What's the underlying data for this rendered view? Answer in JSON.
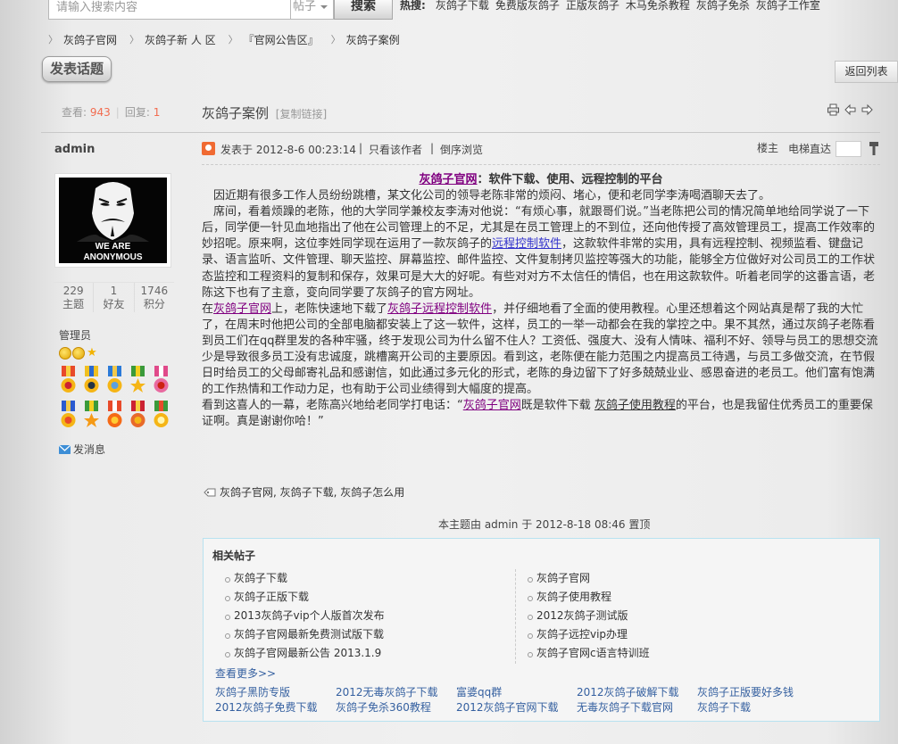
{
  "search": {
    "placeholder": "请输入搜索内容",
    "type": "帖子",
    "button": "搜索"
  },
  "hot": {
    "label": "热搜:",
    "items": [
      "灰鸽子下载",
      "免费版灰鸽子",
      "正版灰鸽子",
      "木马免杀教程",
      "灰鸽子免杀",
      "灰鸽子工作室"
    ]
  },
  "breadcrumb": [
    "灰鸽子官网",
    "灰鸽子新 人 区",
    "『官网公告区』",
    "灰鸽子案例"
  ],
  "post_button": "发表话题",
  "back_list": "返回列表",
  "thread": {
    "views_label": "查看:",
    "views": "943",
    "replies_label": "回复:",
    "replies": "1",
    "title": "灰鸽子案例",
    "copy_link": "[复制链接]"
  },
  "author": {
    "name": "admin",
    "avatar_text": [
      "WE ARE",
      "ANONYMOUS"
    ],
    "stats": [
      {
        "value": "229",
        "label": "主题"
      },
      {
        "value": "1",
        "label": "好友"
      },
      {
        "value": "1746",
        "label": "积分"
      }
    ],
    "group": "管理员",
    "message": "发消息"
  },
  "post_info": {
    "posted": "发表于  2012-8-6 00:23:14",
    "only_author": "只看该作者",
    "reverse": "倒序浏览",
    "floor_owner": "楼主",
    "jump": "电梯直达"
  },
  "post": {
    "heading_link": "灰鸽子官网",
    "heading_rest": "：软件下载、使用、远程控制的平台",
    "p1": "因近期有很多工作人员纷纷跳槽，某文化公司的领导老陈非常的烦闷、堵心，便和老同学李涛喝酒聊天去了。",
    "p2a": "席间，看着烦躁的老陈，他的大学同学兼校友李涛对他说：“有烦心事，就跟哥们说。”当老陈把公司的情况简单地给同学说了一下后，同学便一针见血地指出了他在公司管理上的不足，尤其是在员工管理上的不到位，还向他传授了高效管理员工，提高工作效率的妙招呢。原来啊，这位李姓同学现在运用了一款灰鸽子的",
    "p2link": "远程控制软件",
    "p2b": "，这款软件非常的实用，具有远程控制、视频监看、键盘记录、语言监听、文件管理、聊天监控、屏幕监控、邮件监控、文件复制拷贝监控等强大的功能，能够全方位做好对公司员工的工作状态监控和工程资料的复制和保存，效果可是大大的好呢。有些对对方不太信任的情侣，也在用这款软件。听着老同学的这番言语，老陈这下也有了主意，变向同学要了灰鸽子的官方网址。",
    "p3a": "在",
    "p3link1": "灰鸽子官网",
    "p3b": "上，老陈快速地下载了",
    "p3link2": "灰鸽子远程控制软件",
    "p3c": "，并仔细地看了全面的使用教程。心里还想着这个网站真是帮了我的大忙了，在周末时他把公司的全部电脑都安装上了这一软件，这样，员工的一举一动都会在我的掌控之中。果不其然，通过灰鸽子老陈看到员工们在qq群里发的各种牢骚，终于发现公司为什么留不住人？工资低、强度大、没有人情味、福利不好、领导与员工的思想交流少是导致很多员工没有忠诚度，跳槽离开公司的主要原因。看到这，老陈便在能力范围之内提高员工待遇，与员工多做交流，在节假日时给员工的父母邮寄礼品和感谢信，如此通过多元化的形式，老陈的身边留下了好多兢兢业业、感恩奋进的老员工。他们富有饱满的工作热情和工作动力足，也有助于公司业绩得到大幅度的提高。",
    "p4a": "看到这喜人的一幕，老陈高兴地给老同学打电话：“",
    "p4link1": "灰鸽子官网",
    "p4b": "既是软件下载 ",
    "p4link2": "灰鸽子使用教程",
    "p4c": "的平台，也是我留住优秀员工的重要保证啊。真是谢谢你哈！”"
  },
  "tags": "灰鸽子官网, 灰鸽子下载, 灰鸽子怎么用",
  "top_note": "本主题由  admin  于  2012-8-18 08:46 置顶",
  "related": {
    "title": "相关帖子",
    "left": [
      "灰鸽子下载",
      "灰鸽子正版下载",
      "2013灰鸽子vip个人版首次发布",
      "灰鸽子官网最新免费测试版下载",
      "灰鸽子官网最新公告  2013.1.9"
    ],
    "right": [
      "灰鸽子官网",
      "灰鸽子使用教程",
      "2012灰鸽子测试版",
      "灰鸽子远控vip办理",
      "灰鸽子官网c语言特训班"
    ],
    "more": "查看更多>>",
    "links": [
      "灰鸽子黑防专版",
      "2012无毒灰鸽子下载",
      "富婆qq群",
      "2012灰鸽子破解下载",
      "灰鸽子正版要好多钱",
      "2012灰鸽子免费下载",
      "灰鸽子免杀360教程",
      "2012灰鸽子官网下载",
      "无毒灰鸽子下载官网",
      "灰鸽子下载"
    ]
  }
}
